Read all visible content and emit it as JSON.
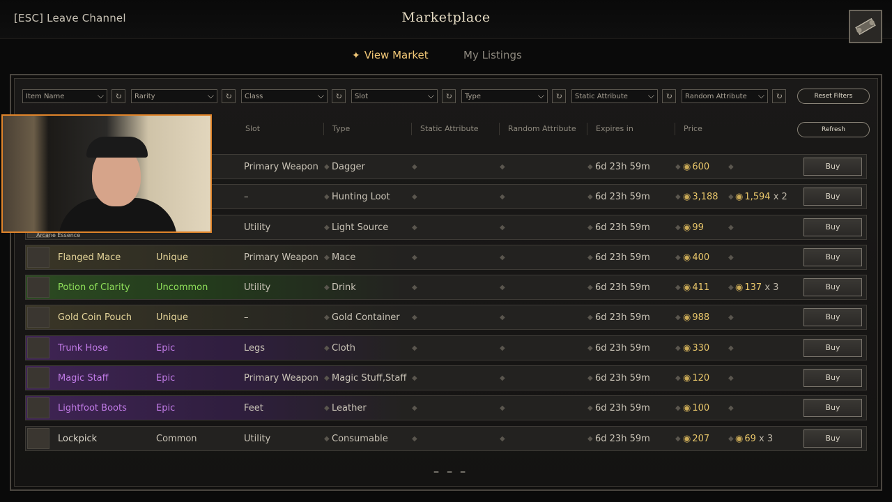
{
  "header": {
    "leave_label": "[ESC] Leave Channel",
    "title": "Marketplace"
  },
  "tabs": [
    {
      "label": "View Market",
      "active": true
    },
    {
      "label": "My Listings",
      "active": false
    }
  ],
  "filters": [
    {
      "label": "Item Name"
    },
    {
      "label": "Rarity"
    },
    {
      "label": "Class"
    },
    {
      "label": "Slot"
    },
    {
      "label": "Type"
    },
    {
      "label": "Static Attribute"
    },
    {
      "label": "Random Attribute"
    }
  ],
  "buttons": {
    "reset_filters": "Reset Filters",
    "refresh": "Refresh",
    "buy": "Buy"
  },
  "columns": {
    "slot": "Slot",
    "type": "Type",
    "static_attribute": "Static Attribute",
    "random_attribute": "Random Attribute",
    "expires_in": "Expires in",
    "price": "Price"
  },
  "rows": [
    {
      "name": "",
      "rarity": "",
      "slot": "Primary Weapon",
      "type": "Dagger",
      "expires": "6d 23h 59m",
      "price": "600",
      "unit": "",
      "rclass": ""
    },
    {
      "name": "",
      "rarity": "",
      "slot": "–",
      "type": "Hunting Loot",
      "expires": "6d 23h 59m",
      "price": "3,188",
      "unit": "1,594",
      "qty": "x 2",
      "rclass": ""
    },
    {
      "name": "",
      "rarity": "",
      "slot": "Utility",
      "type": "Light Source",
      "expires": "6d 23h 59m",
      "price": "99",
      "unit": "",
      "rclass": ""
    },
    {
      "name": "Flanged Mace",
      "rarity": "Unique",
      "slot": "Primary Weapon",
      "type": "Mace",
      "expires": "6d 23h 59m",
      "price": "400",
      "unit": "",
      "rclass": "r-unique"
    },
    {
      "name": "Potion of Clarity",
      "rarity": "Uncommon",
      "slot": "Utility",
      "type": "Drink",
      "expires": "6d 23h 59m",
      "price": "411",
      "unit": "137",
      "qty": "x 3",
      "rclass": "r-uncommon"
    },
    {
      "name": "Gold Coin Pouch",
      "rarity": "Unique",
      "slot": "–",
      "type": "Gold Container",
      "expires": "6d 23h 59m",
      "price": "988",
      "unit": "",
      "rclass": "r-unique"
    },
    {
      "name": "Trunk Hose",
      "rarity": "Epic",
      "slot": "Legs",
      "type": "Cloth",
      "expires": "6d 23h 59m",
      "price": "330",
      "unit": "",
      "rclass": "r-epic"
    },
    {
      "name": "Magic Staff",
      "rarity": "Epic",
      "slot": "Primary Weapon",
      "type": "Magic Stuff,Staff",
      "expires": "6d 23h 59m",
      "price": "120",
      "unit": "",
      "rclass": "r-epic"
    },
    {
      "name": "Lightfoot Boots",
      "rarity": "Epic",
      "slot": "Feet",
      "type": "Leather",
      "expires": "6d 23h 59m",
      "price": "100",
      "unit": "",
      "rclass": "r-epic"
    },
    {
      "name": "Lockpick",
      "rarity": "Common",
      "slot": "Utility",
      "type": "Consumable",
      "expires": "6d 23h 59m",
      "price": "207",
      "unit": "69",
      "qty": "x 3",
      "rclass": "r-common"
    }
  ],
  "overlay_label": "Arcane Essence",
  "pager": "– – –"
}
